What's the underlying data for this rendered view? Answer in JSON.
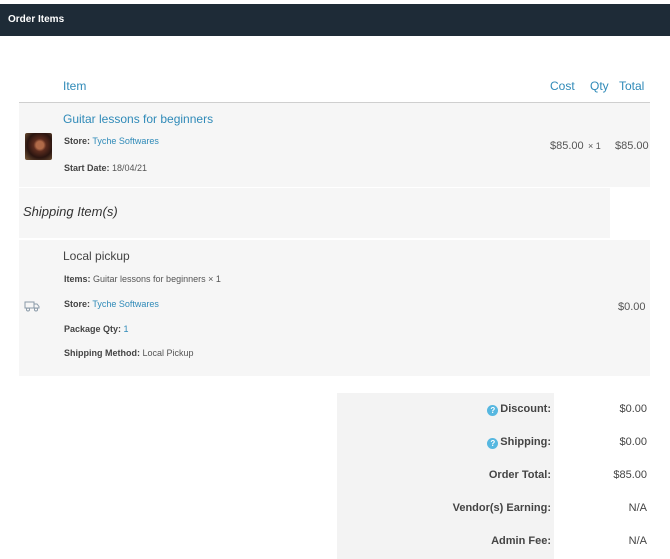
{
  "header": {
    "title": "Order Items"
  },
  "columns": {
    "item": "Item",
    "cost": "Cost",
    "qty": "Qty",
    "total": "Total"
  },
  "line_item": {
    "name": "Guitar lessons for beginners",
    "store_label": "Store:",
    "store_value": "Tyche Softwares",
    "start_date_label": "Start Date:",
    "start_date_value": "18/04/21",
    "cost": "$85.00",
    "qty": "× 1",
    "total": "$85.00"
  },
  "shipping": {
    "heading": "Shipping Item(s)",
    "method_name": "Local pickup",
    "items_label": "Items:",
    "items_value": "Guitar lessons for beginners × 1",
    "store_label": "Store:",
    "store_value": "Tyche Softwares",
    "package_qty_label": "Package Qty:",
    "package_qty_value": "1",
    "shipping_method_label": "Shipping Method:",
    "shipping_method_value": "Local Pickup",
    "total": "$0.00"
  },
  "totals": {
    "discount_label": "Discount:",
    "discount_value": "$0.00",
    "shipping_label": "Shipping:",
    "shipping_value": "$0.00",
    "order_total_label": "Order Total:",
    "order_total_value": "$85.00",
    "vendor_earning_label": "Vendor(s) Earning:",
    "vendor_earning_value": "N/A",
    "admin_fee_label": "Admin Fee:",
    "admin_fee_value": "N/A",
    "help_icon_glyph": "?"
  },
  "colors": {
    "header_bg": "#1e2b37",
    "accent": "#2f8ab8",
    "help_icon": "#56b7e0"
  }
}
